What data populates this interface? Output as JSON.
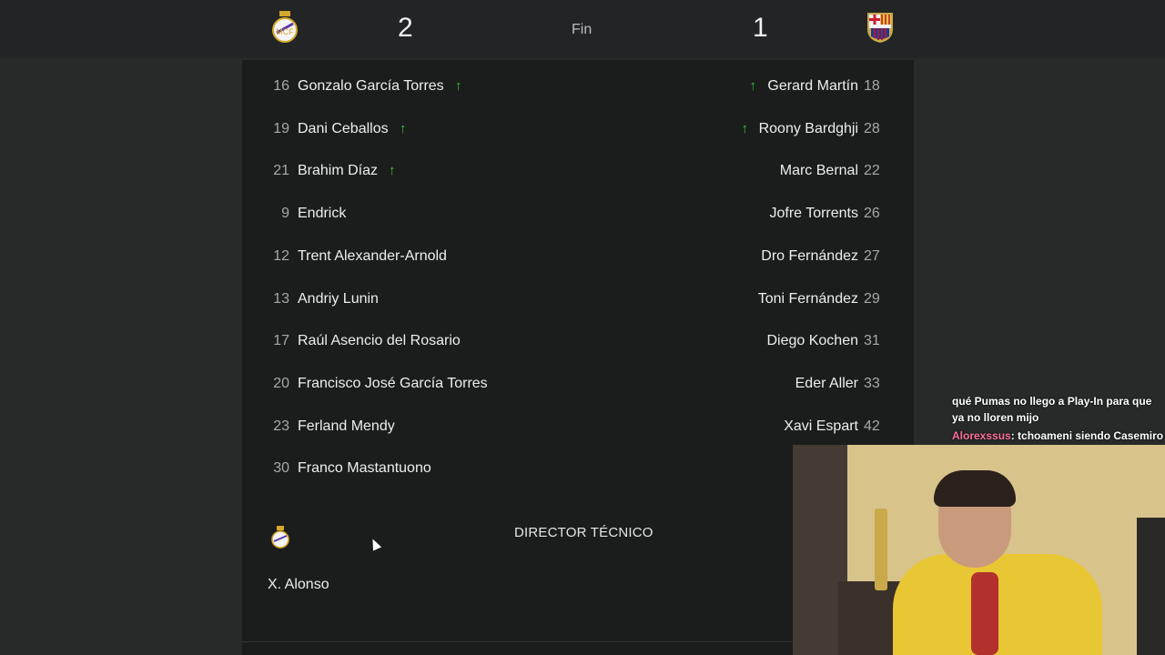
{
  "match": {
    "home_score": "2",
    "away_score": "1",
    "status": "Fin",
    "home_crest": "real-madrid-crest",
    "away_crest": "fc-barcelona-crest"
  },
  "home_players": [
    {
      "num": "16",
      "name": "Gonzalo García Torres",
      "sub_in": true
    },
    {
      "num": "19",
      "name": "Dani Ceballos",
      "sub_in": true
    },
    {
      "num": "21",
      "name": "Brahim Díaz",
      "sub_in": true
    },
    {
      "num": "9",
      "name": "Endrick",
      "sub_in": false
    },
    {
      "num": "12",
      "name": "Trent Alexander-Arnold",
      "sub_in": false
    },
    {
      "num": "13",
      "name": "Andriy Lunin",
      "sub_in": false
    },
    {
      "num": "17",
      "name": "Raúl Asencio del Rosario",
      "sub_in": false
    },
    {
      "num": "20",
      "name": "Francisco José García Torres",
      "sub_in": false
    },
    {
      "num": "23",
      "name": "Ferland Mendy",
      "sub_in": false
    },
    {
      "num": "30",
      "name": "Franco Mastantuono",
      "sub_in": false
    }
  ],
  "away_players": [
    {
      "num": "18",
      "name": "Gerard Martín",
      "sub_in": true
    },
    {
      "num": "28",
      "name": "Roony Bardghji",
      "sub_in": true
    },
    {
      "num": "22",
      "name": "Marc Bernal",
      "sub_in": false
    },
    {
      "num": "26",
      "name": "Jofre Torrents",
      "sub_in": false
    },
    {
      "num": "27",
      "name": "Dro Fernández",
      "sub_in": false
    },
    {
      "num": "29",
      "name": "Toni Fernández",
      "sub_in": false
    },
    {
      "num": "31",
      "name": "Diego Kochen",
      "sub_in": false
    },
    {
      "num": "33",
      "name": "Eder Aller",
      "sub_in": false
    },
    {
      "num": "42",
      "name": "Xavi Espart",
      "sub_in": false
    }
  ],
  "coach": {
    "section_label": "DIRECTOR TÉCNICO",
    "home_name": "X. Alonso"
  },
  "chat": {
    "line1": "qué Pumas no llego a Play-In para que ya no lloren mijo",
    "user2": "Alorexssus",
    "msg2": ": tchoameni siendo Casemiro"
  },
  "colors": {
    "background": "#272a29",
    "panel": "#1b1c1c",
    "sub_arrow": "#3ec23e",
    "chat_username": "#ff6f9a"
  }
}
